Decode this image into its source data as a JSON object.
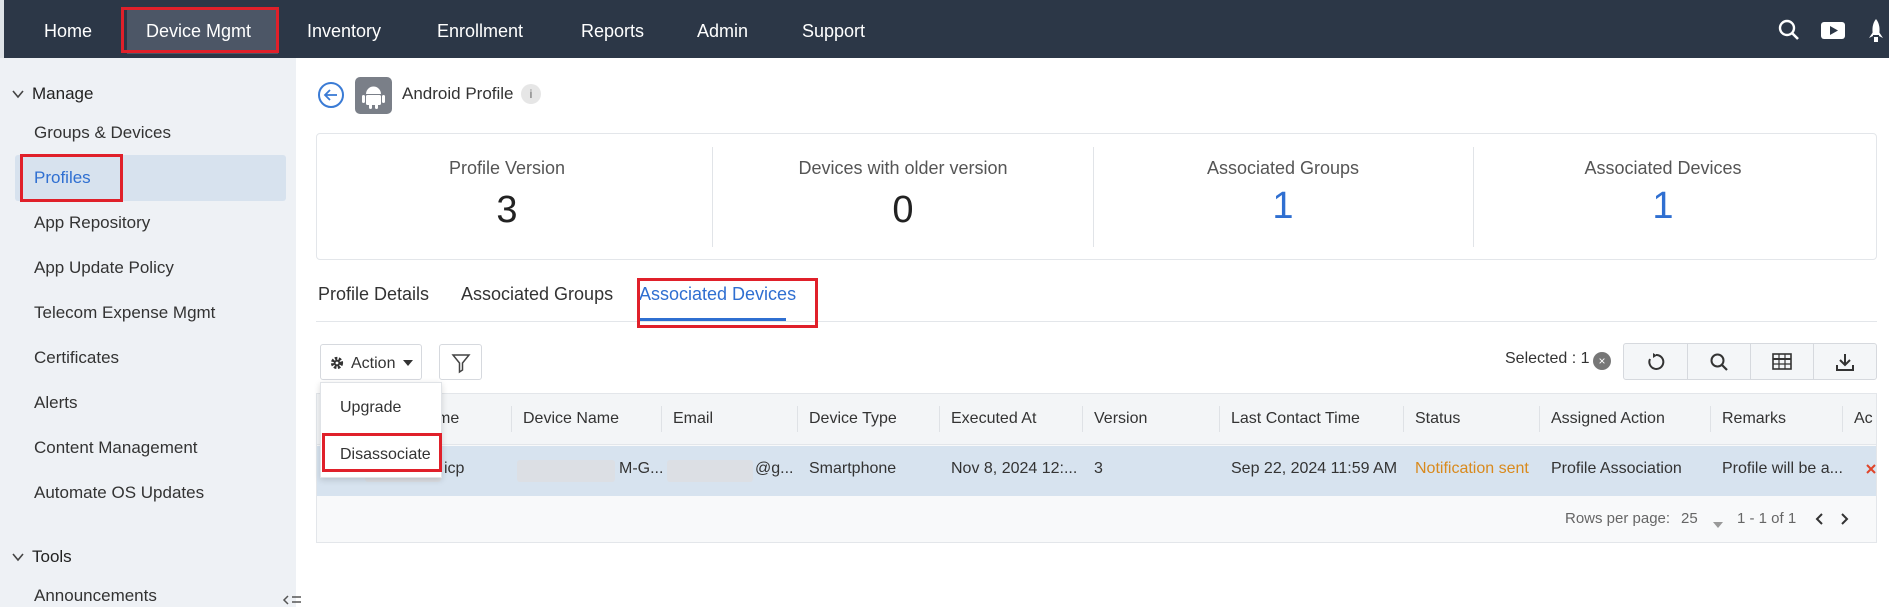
{
  "nav": {
    "items": [
      "Home",
      "Device Mgmt",
      "Inventory",
      "Enrollment",
      "Reports",
      "Admin",
      "Support"
    ],
    "icons": [
      "search-icon",
      "youtube-icon",
      "rocket-icon",
      "bolt-icon"
    ]
  },
  "sidebar": {
    "sections": [
      "Manage",
      "Tools"
    ],
    "items": [
      "Groups & Devices",
      "Profiles",
      "App Repository",
      "App Update Policy",
      "Telecom Expense Mgmt",
      "Certificates",
      "Alerts",
      "Content Management",
      "Automate OS Updates"
    ],
    "tools_items": [
      "Announcements"
    ]
  },
  "profile": {
    "title": "Android Profile",
    "info": "i"
  },
  "stats": [
    {
      "label": "Profile Version",
      "value": "3"
    },
    {
      "label": "Devices with older version",
      "value": "0"
    },
    {
      "label": "Associated Groups",
      "value": "1"
    },
    {
      "label": "Associated Devices",
      "value": "1"
    }
  ],
  "tabs": [
    "Profile Details",
    "Associated Groups",
    "Associated Devices"
  ],
  "toolbar": {
    "action_label": "Action",
    "selected_text": "Selected : 1"
  },
  "dropdown": [
    "Upgrade",
    "Disassociate"
  ],
  "table": {
    "headers": [
      "me",
      "Device Name",
      "Email",
      "Device Type",
      "Executed At",
      "Version",
      "Last Contact Time",
      "Status",
      "Assigned Action",
      "Remarks",
      "Ac"
    ],
    "row": {
      "name_suffix": "icp",
      "device_name_suffix": "M-G...",
      "email_suffix": "@g...",
      "device_type": "Smartphone",
      "executed_at": "Nov 8, 2024 12:...",
      "version": "3",
      "last_contact": "Sep 22, 2024 11:59 AM",
      "status": "Notification sent",
      "assigned_action": "Profile Association",
      "remarks": "Profile will be a..."
    }
  },
  "pager": {
    "rows_label": "Rows per page:",
    "rows_value": "25",
    "range": "1 - 1 of 1"
  },
  "colors": {
    "nav_bg": "#2c3747",
    "accent": "#2f6fd1",
    "highlight_red": "#e0202a",
    "status_orange": "#d98a1d"
  }
}
